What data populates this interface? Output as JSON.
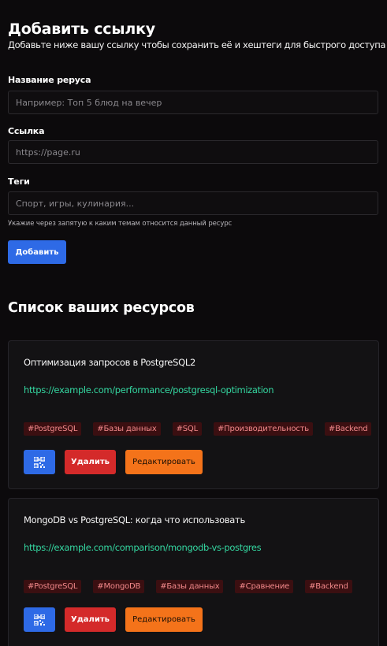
{
  "form": {
    "title": "Добавить ссылку",
    "subtitle": "Добавьте ниже вашу ссылку чтобы сохранить её и хештеги для быстрого доступа",
    "name_label": "Название реруса",
    "name_placeholder": "Например: Топ 5 блюд на вечер",
    "link_label": "Ссылка",
    "link_placeholder": "https://page.ru",
    "tags_label": "Теги",
    "tags_placeholder": "Спорт, игры, кулинария...",
    "tags_hint": "Укажие через запятую к каким темам относится данный ресурс",
    "add_button": "Добавить"
  },
  "list": {
    "title": "Список ваших ресурсов",
    "items": [
      {
        "title": "Оптимизация запросов в PostgreSQL2",
        "url": "https://example.com/performance/postgresql-optimization",
        "tags": [
          "#PostgreSQL",
          "#Базы данных",
          "#SQL",
          "#Производительность",
          "#Backend"
        ],
        "delete_label": "Удалить",
        "edit_label": "Редактировать",
        "qr_icon": "qr-code-icon"
      },
      {
        "title": "MongoDB vs PostgreSQL: когда что использовать",
        "url": "https://example.com/comparison/mongodb-vs-postgres",
        "tags": [
          "#PostgreSQL",
          "#MongoDB",
          "#Базы данных",
          "#Сравнение",
          "#Backend"
        ],
        "delete_label": "Удалить",
        "edit_label": "Редактировать",
        "qr_icon": "qr-code-icon"
      }
    ]
  },
  "colors": {
    "background": "#0c0a0c",
    "primary": "#2e6ae6",
    "danger": "#d42a2a",
    "warning": "#f4731a",
    "link": "#34d6a0",
    "tag_bg": "#3b0f11",
    "tag_text": "#f1888a"
  }
}
